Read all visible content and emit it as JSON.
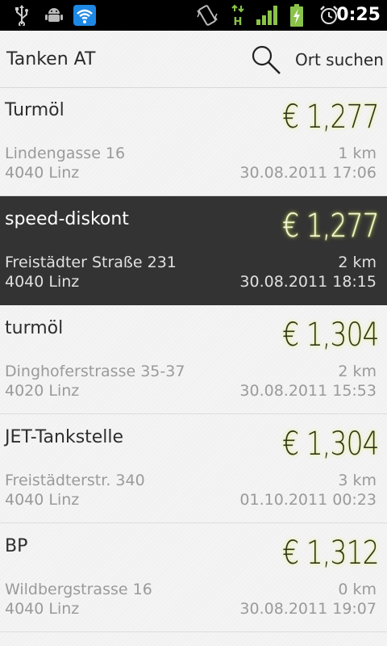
{
  "status_bar": {
    "time": "0:25",
    "icons": [
      "usb-icon",
      "android-debug-icon",
      "wifi-icon",
      "vibrate-icon",
      "hspa-signal-icon",
      "cell-signal-icon",
      "battery-charging-icon",
      "alarm-clock-icon"
    ]
  },
  "app": {
    "title": "Tanken AT",
    "search_label": "Ort suchen"
  },
  "stations": [
    {
      "name": "Turmöl",
      "price": "€ 1,277",
      "street": "Lindengasse 16",
      "city": "4040 Linz",
      "distance": "1 km",
      "date": "30.08.2011 17:06"
    },
    {
      "name": "speed-diskont",
      "price": "€ 1,277",
      "street": "Freistädter Straße 231",
      "city": "4040 Linz",
      "distance": "2 km",
      "date": "30.08.2011 18:15"
    },
    {
      "name": "turmöl",
      "price": "€ 1,304",
      "street": "Dinghoferstrasse 35-37",
      "city": "4020 Linz",
      "distance": "2 km",
      "date": "30.08.2011 15:53"
    },
    {
      "name": "JET-Tankstelle",
      "price": "€ 1,304",
      "street": "Freistädterstr. 340",
      "city": "4040 Linz",
      "distance": "3 km",
      "date": "01.10.2011 00:23"
    },
    {
      "name": "BP",
      "price": "€ 1,312",
      "street": "Wildbergstrasse 16",
      "city": "4040 Linz",
      "distance": "0 km",
      "date": "30.08.2011 19:07"
    }
  ],
  "colors": {
    "selected_row": "#333333",
    "price_glow": "#e6f078",
    "wifi_accent": "#1e88e5",
    "signal_green": "#8bc34a"
  }
}
